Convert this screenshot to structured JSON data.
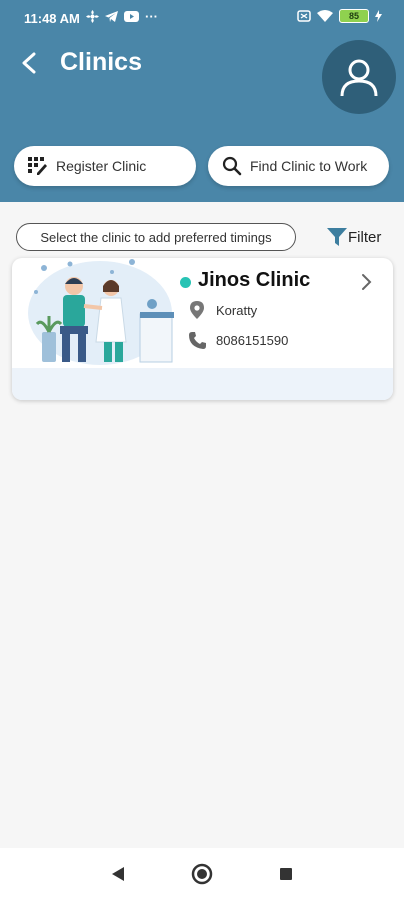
{
  "status_bar": {
    "time": "11:48 AM",
    "more": "···",
    "battery": "85"
  },
  "header": {
    "title": "Clinics"
  },
  "actions": {
    "register_label": "Register Clinic",
    "find_label": "Find Clinic to Work"
  },
  "hint": "Select the clinic to add preferred timings",
  "filter_label": "Filter",
  "clinics": [
    {
      "name": "Jinos Clinic",
      "location": "Koratty",
      "phone": "8086151590",
      "status": "active"
    }
  ],
  "colors": {
    "header": "#4a86a8",
    "avatar_bg": "#2f5f79",
    "status_dot": "#27c3b4",
    "card_footer": "#edf3fa"
  },
  "icons": {
    "back": "arrow-left-icon",
    "avatar": "user-icon",
    "register": "grid-edit-icon",
    "find": "search-icon",
    "filter": "filter-icon",
    "location": "location-pin-icon",
    "phone": "phone-icon",
    "chevron": "chevron-right-icon"
  }
}
